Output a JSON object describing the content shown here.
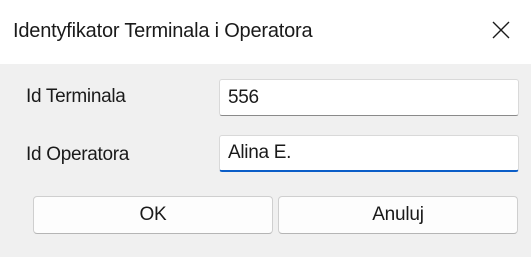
{
  "window": {
    "title": "Identyfikator Terminala i Operatora",
    "close_icon": "close-icon"
  },
  "form": {
    "terminal_label": "Id Terminala",
    "terminal_value": "556",
    "operator_label": "Id Operatora",
    "operator_value": "Alina E."
  },
  "buttons": {
    "ok_label": "OK",
    "cancel_label": "Anuluj"
  },
  "colors": {
    "titlebar_bg": "#ffffff",
    "body_bg": "#f0f0f0",
    "focus_accent": "#0b5ec8"
  }
}
